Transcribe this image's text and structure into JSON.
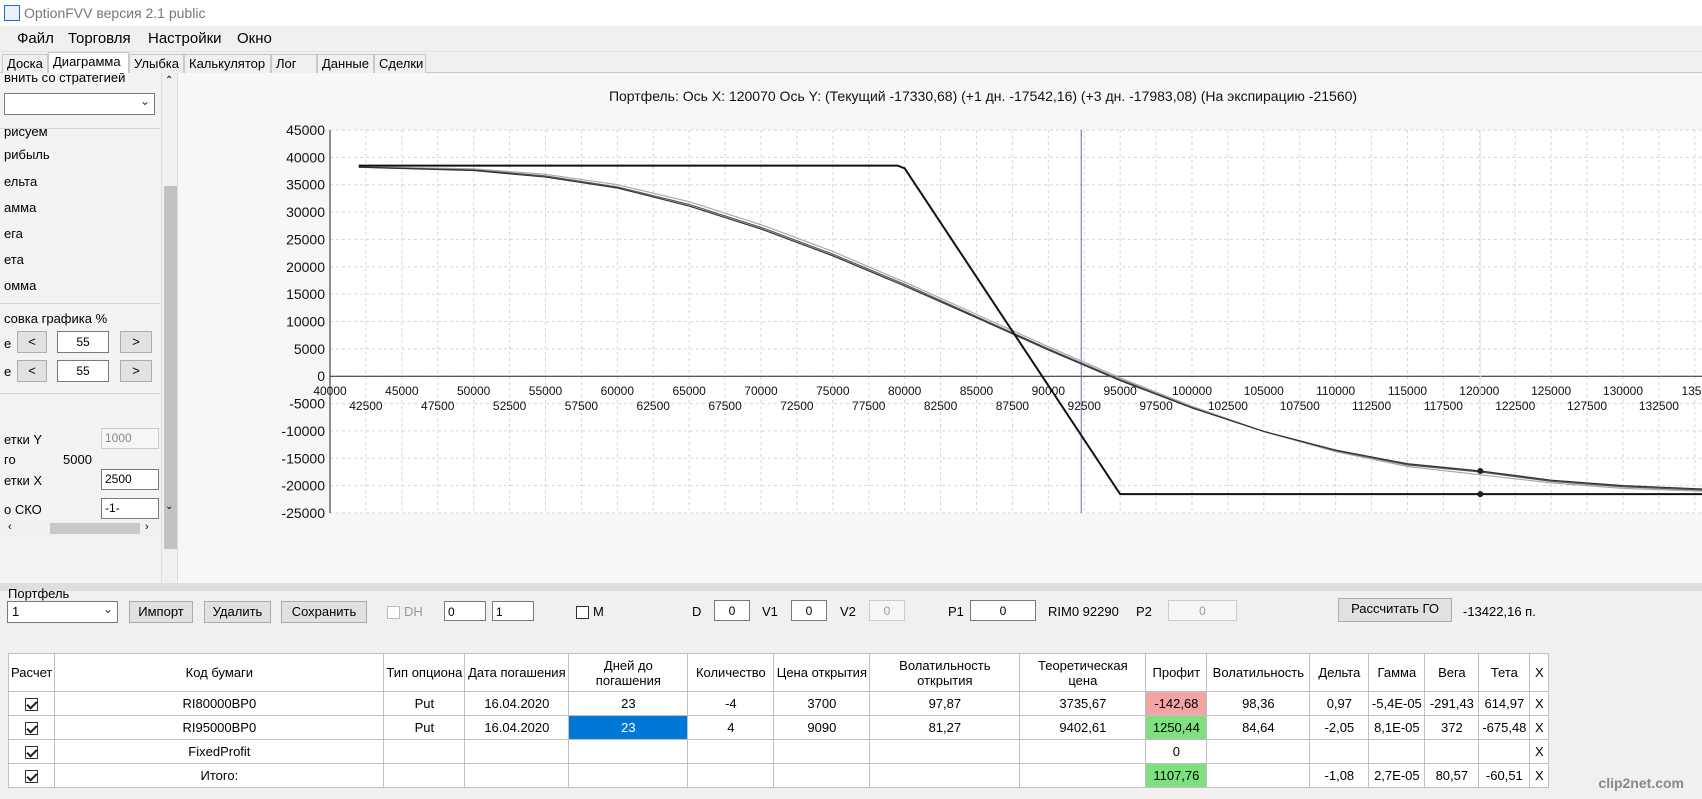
{
  "app": {
    "title": "OptionFVV версия 2.1 public"
  },
  "menu": [
    "Файл",
    "Торговля",
    "Настройки",
    "Окно"
  ],
  "tabs": [
    "Доска",
    "Диаграмма",
    "Улыбка",
    "Калькулятор",
    "Лог",
    "Данные",
    "Сделки"
  ],
  "left_panel": {
    "compare_label": "внить со стратегией",
    "draw_header": "рисуем",
    "options": [
      "рибыль",
      "ельта",
      "амма",
      "ега",
      "ета",
      "омма"
    ],
    "scale_header": "совка графика %",
    "row1_prefix": "е",
    "row2_prefix": "е",
    "value1": "55",
    "value2": "55",
    "less": "<",
    "more": ">",
    "grid_y_label": "етки Y",
    "grid_y_value": "1000",
    "step_label": "го",
    "step_value": "5000",
    "grid_x_label": "етки X",
    "grid_x_value": "2500",
    "sko_label": "о СКО",
    "sko_value": "-1-"
  },
  "chart_data": {
    "type": "line",
    "title": "Портфель: Ось X: 120070 Ось Y:  (Текущий -17330,68)  (+1 дн. -17542,16)  (+3 дн. -17983,08)  (На экспирацию -21560)",
    "xlim": [
      40000,
      135500
    ],
    "ylim": [
      -25000,
      45000
    ],
    "y_ticks": [
      45000,
      40000,
      35000,
      30000,
      25000,
      20000,
      15000,
      10000,
      5000,
      0,
      -5000,
      -10000,
      -15000,
      -20000,
      -25000
    ],
    "x_ticks_upper": [
      40000,
      45000,
      50000,
      55000,
      60000,
      65000,
      70000,
      75000,
      80000,
      85000,
      90000,
      95000,
      100000,
      105000,
      110000,
      115000,
      120000,
      125000,
      130000,
      1350
    ],
    "x_ticks_lower": [
      42500,
      47500,
      52500,
      57500,
      62500,
      67500,
      72500,
      77500,
      82500,
      87500,
      92500,
      97500,
      102500,
      107500,
      112500,
      117500,
      122500,
      127500,
      132500
    ],
    "vertical_marker_x": 92290,
    "cursor_x": 120070,
    "series": [
      {
        "color": "#111111",
        "x": [
          42000,
          79500,
          80000,
          95000,
          135500
        ],
        "values": [
          38500,
          38500,
          38000,
          -21560,
          -21560
        ]
      },
      {
        "color": "#333333",
        "x": [
          42000,
          50000,
          55000,
          60000,
          65000,
          70000,
          75000,
          80000,
          85000,
          90000,
          95000,
          100000,
          105000,
          110000,
          115000,
          120000,
          125000,
          130000,
          135500
        ],
        "values": [
          38200,
          37600,
          36400,
          34400,
          31100,
          26900,
          22000,
          16500,
          10700,
          4800,
          -800,
          -5800,
          -10100,
          -13500,
          -16000,
          -17300,
          -19000,
          -20000,
          -20600
        ]
      },
      {
        "color": "#555555",
        "x": [
          42000,
          50000,
          55000,
          60000,
          65000,
          70000,
          75000,
          80000,
          85000,
          90000,
          95000,
          100000,
          105000,
          110000,
          115000,
          120000,
          125000,
          130000,
          135500
        ],
        "values": [
          38200,
          37700,
          36600,
          34600,
          31400,
          27200,
          22300,
          16800,
          10900,
          5000,
          -600,
          -5700,
          -10100,
          -13600,
          -16200,
          -17500,
          -19200,
          -20200,
          -20800
        ]
      },
      {
        "color": "#a8a8a8",
        "x": [
          42000,
          50000,
          55000,
          60000,
          65000,
          70000,
          75000,
          80000,
          85000,
          90000,
          95000,
          100000,
          105000,
          110000,
          115000,
          120000,
          125000,
          130000,
          135500
        ],
        "values": [
          38300,
          37900,
          36900,
          35000,
          31900,
          27700,
          22800,
          17200,
          11300,
          5400,
          -300,
          -5500,
          -10100,
          -13800,
          -16500,
          -18000,
          -19500,
          -20500,
          -21000
        ]
      }
    ],
    "markers": [
      {
        "x": 120070,
        "y": -17330.68
      },
      {
        "x": 120070,
        "y": -21560
      }
    ]
  },
  "portfolio": {
    "title": "Портфель",
    "account": "1",
    "import": "Импорт",
    "delete": "Удалить",
    "save": "Сохранить",
    "dh": "DH",
    "spin1": "0",
    "spin2": "1",
    "m": "M",
    "d_label": "D",
    "d_value": "0",
    "v1_label": "V1",
    "v1_value": "0",
    "v2_label": "V2",
    "v2_value": "0",
    "p1_label": "P1",
    "p1_value": "0",
    "underlying": "RIM0 92290",
    "p2_label": "P2",
    "p2_value": "0",
    "calc_go": "Рассчитать ГО",
    "go_value": "-13422,16 п."
  },
  "table": {
    "columns": [
      "Расчет",
      "Код бумаги",
      "Тип опциона",
      "Дата погашения",
      "Дней до погашения",
      "Количество",
      "Цена открытия",
      "Волатильность открытия",
      "Теоретическая цена",
      "Профит",
      "Волатильность",
      "Дельта",
      "Гамма",
      "Вега",
      "Тета",
      "X"
    ],
    "rows": [
      [
        "",
        "RI80000BP0",
        "Put",
        "16.04.2020",
        "23",
        "-4",
        "3700",
        "97,87",
        "3735,67",
        "-142,68",
        "98,36",
        "0,97",
        "-5,4E-05",
        "-291,43",
        "614,97",
        "X"
      ],
      [
        "",
        "RI95000BP0",
        "Put",
        "16.04.2020",
        "23",
        "4",
        "9090",
        "81,27",
        "9402,61",
        "1250,44",
        "84,64",
        "-2,05",
        "8,1E-05",
        "372",
        "-675,48",
        "X"
      ],
      [
        "",
        "FixedProfit",
        "",
        "",
        "",
        "",
        "",
        "",
        "",
        "0",
        "",
        "",
        "",
        "",
        "",
        "X"
      ],
      [
        "",
        "Итого:",
        "",
        "",
        "",
        "",
        "",
        "",
        "",
        "1107,76",
        "",
        "-1,08",
        "2,7E-05",
        "80,57",
        "-60,51",
        "X"
      ]
    ]
  },
  "watermark": "clip2net.com"
}
